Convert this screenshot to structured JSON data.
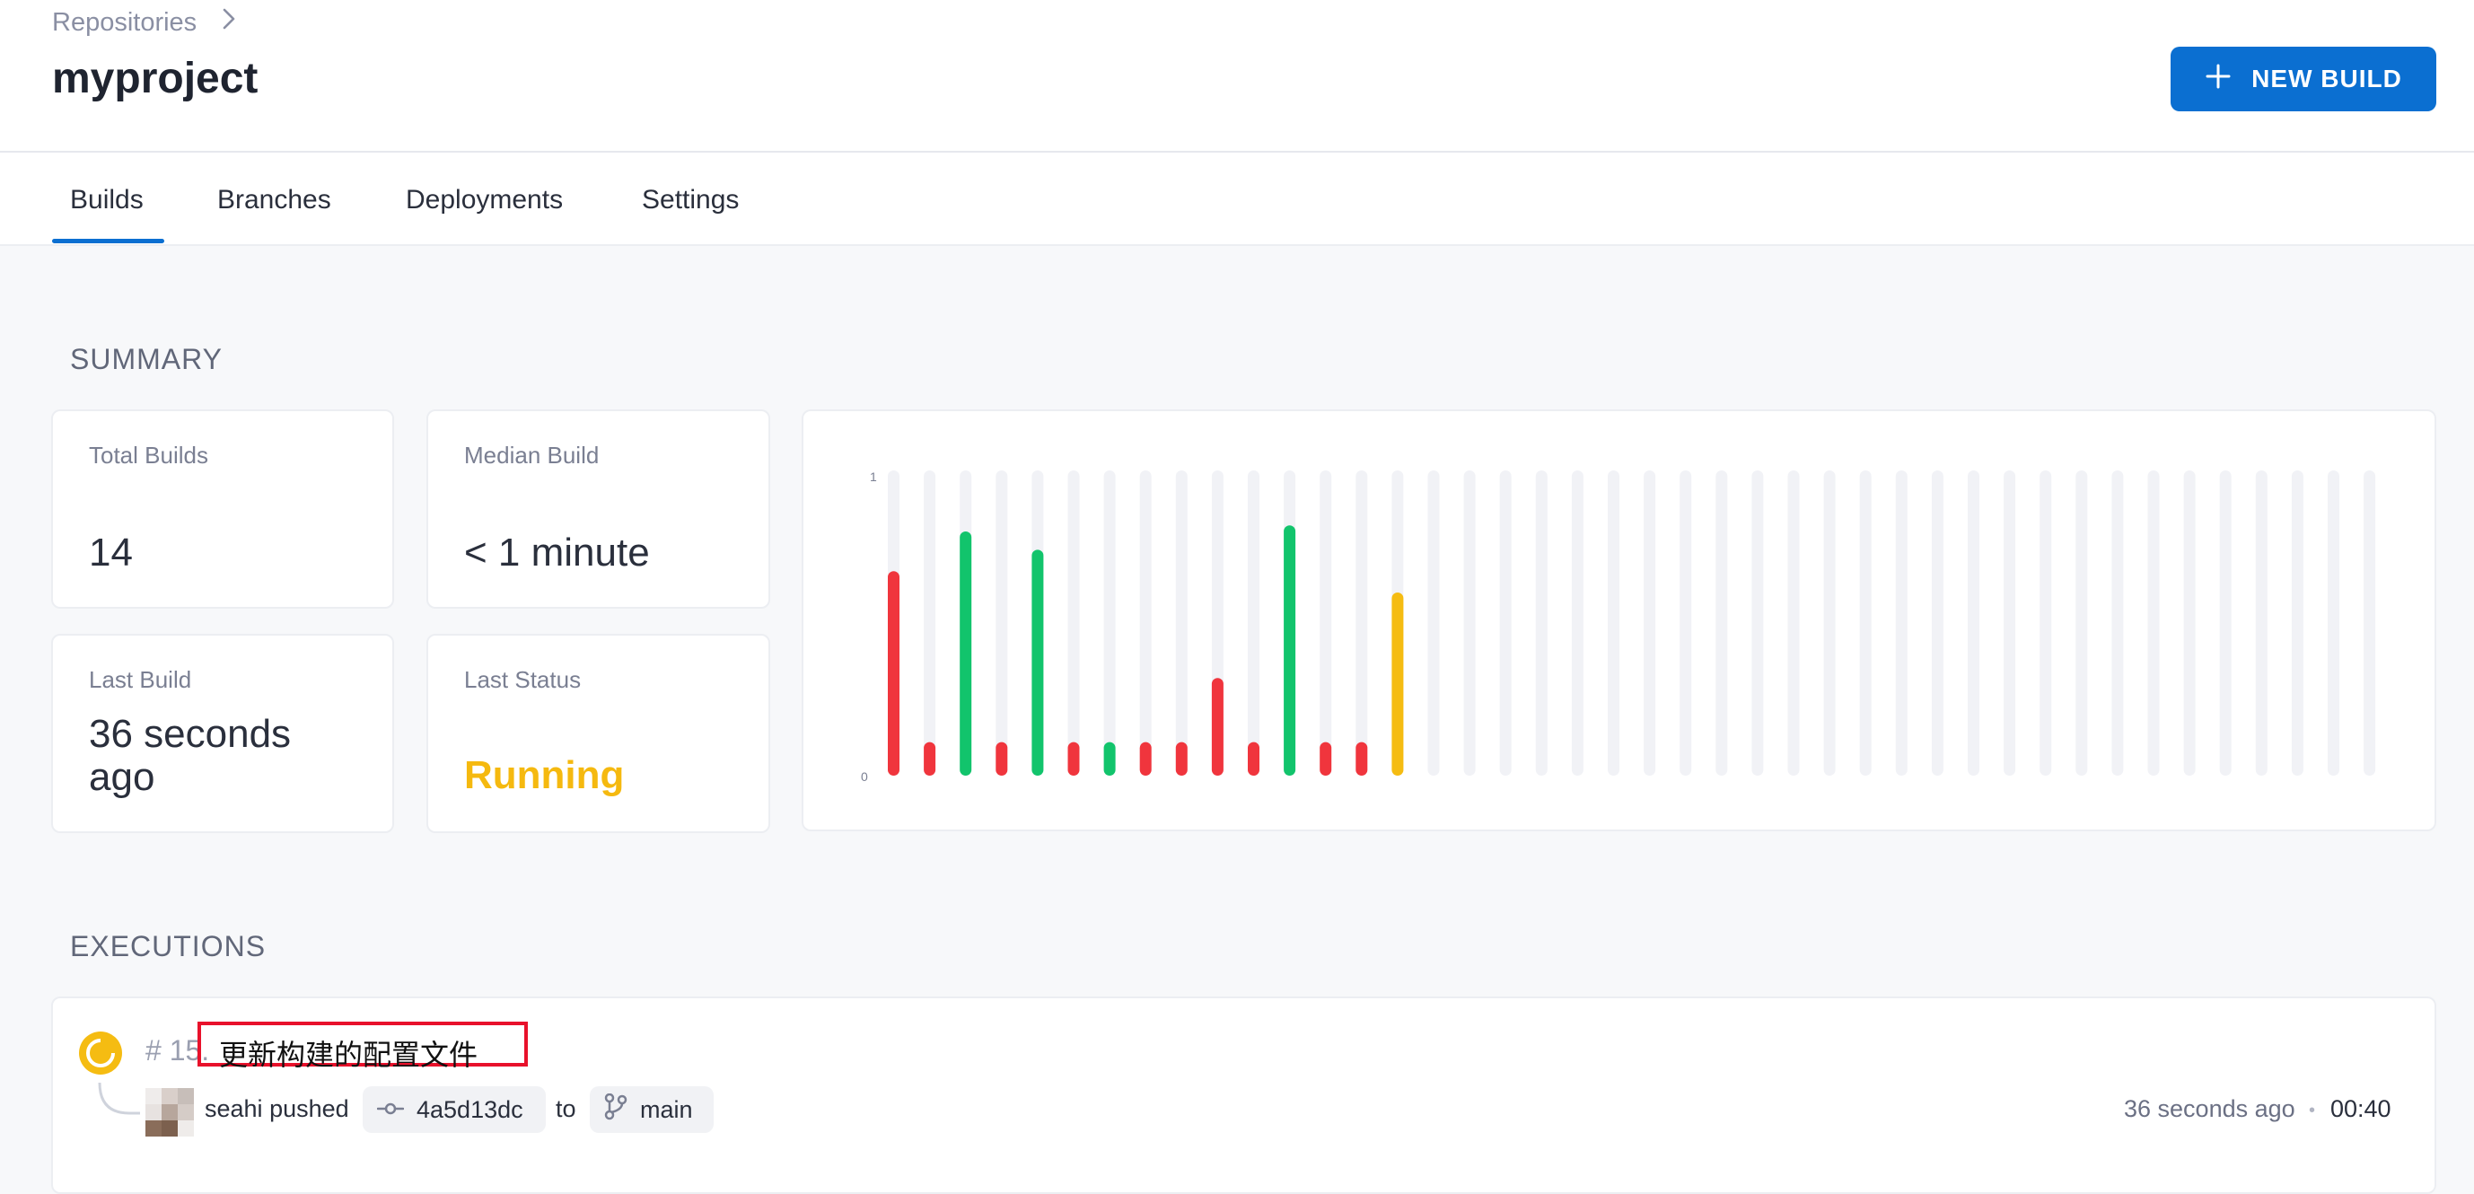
{
  "breadcrumb": {
    "label": "Repositories",
    "separator": "›"
  },
  "page": {
    "title": "myproject"
  },
  "actions": {
    "new_build_label": "NEW BUILD"
  },
  "tabs": [
    {
      "label": "Builds",
      "active": true
    },
    {
      "label": "Branches",
      "active": false
    },
    {
      "label": "Deployments",
      "active": false
    },
    {
      "label": "Settings",
      "active": false
    }
  ],
  "summary": {
    "title": "SUMMARY",
    "total_builds": {
      "label": "Total Builds",
      "value": "14"
    },
    "median_build": {
      "label": "Median Build",
      "value": "< 1 minute"
    },
    "last_build": {
      "label": "Last Build",
      "value": "36 seconds ago"
    },
    "last_status": {
      "label": "Last Status",
      "value": "Running"
    }
  },
  "colors": {
    "accent": "#0b6fd1",
    "failure": "#f0353d",
    "success": "#12c46c",
    "running": "#f5bc12",
    "track": "#f1f2f6"
  },
  "chart_data": {
    "type": "bar",
    "ylim": [
      0,
      1
    ],
    "y_ticks": [
      "1",
      "0"
    ],
    "total_slots": 42,
    "values": [
      0.67,
      0.11,
      0.8,
      0.11,
      0.74,
      0.11,
      0.11,
      0.11,
      0.11,
      0.32,
      0.11,
      0.82,
      0.11,
      0.11,
      0.6
    ],
    "status": [
      "failure",
      "failure",
      "success",
      "failure",
      "success",
      "failure",
      "success",
      "failure",
      "failure",
      "failure",
      "failure",
      "success",
      "failure",
      "failure",
      "running"
    ]
  },
  "executions": {
    "title": "EXECUTIONS",
    "items": [
      {
        "number": "# 15.",
        "message": "更新构建的配置文件",
        "author": "seahi",
        "action": "pushed",
        "commit": "4a5d13dc",
        "to": "to",
        "branch": "main",
        "time_ago": "36 seconds ago",
        "separator": "•",
        "duration": "00:40",
        "status_icon": "running-icon"
      }
    ]
  }
}
